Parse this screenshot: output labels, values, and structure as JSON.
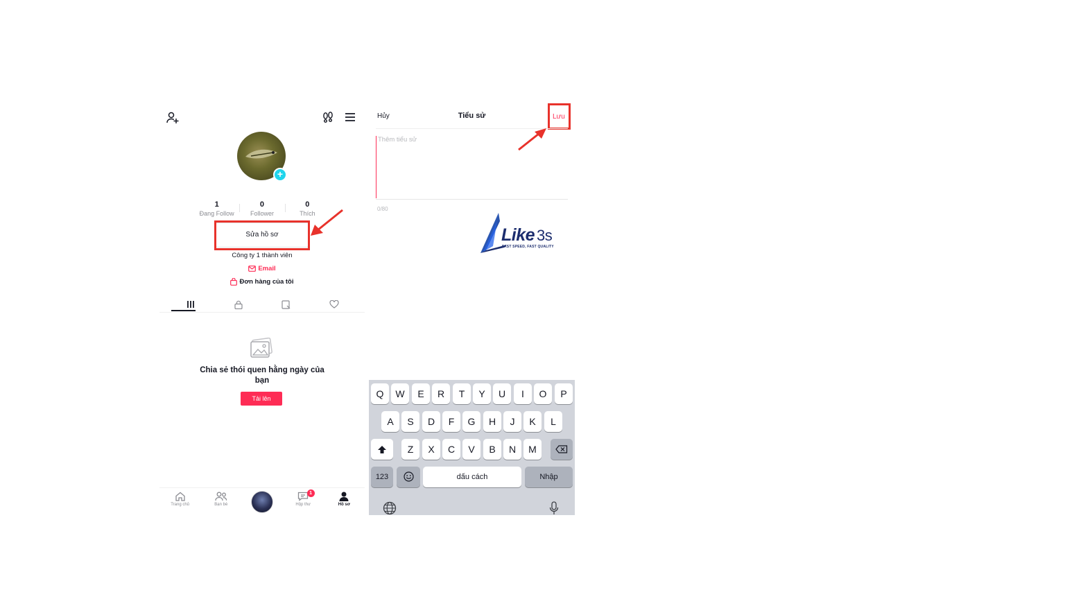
{
  "profile": {
    "stats": [
      {
        "value": "1",
        "label": "Đang Follow"
      },
      {
        "value": "0",
        "label": "Follower"
      },
      {
        "value": "0",
        "label": "Thích"
      }
    ],
    "edit_profile_label": "Sửa hồ sơ",
    "bio_text": "Công ty 1 thành viên",
    "email_label": "Email",
    "orders_label": "Đơn hàng của tôi",
    "empty_title": "Chia sẻ thói quen hằng ngày của bạn",
    "upload_label": "Tải lên",
    "icons": [
      "add-user-icon",
      "footprint-icon",
      "menu-icon",
      "avatar-add-icon",
      "grid-icon",
      "lock-icon",
      "bookmark-icon",
      "liked-icon",
      "empty-photo-icon",
      "mail-icon",
      "bag-icon"
    ]
  },
  "bottom_nav": {
    "items": [
      {
        "label": "Trang chủ",
        "icon": "home-icon"
      },
      {
        "label": "Bạn bè",
        "icon": "friends-icon"
      },
      {
        "label": "",
        "icon": "create-avatar"
      },
      {
        "label": "Hộp thư",
        "icon": "inbox-icon",
        "badge": "1"
      },
      {
        "label": "Hồ sơ",
        "icon": "profile-icon"
      }
    ]
  },
  "bio_editor": {
    "cancel_label": "Hủy",
    "title": "Tiểu sử",
    "save_label": "Lưu",
    "placeholder": "Thêm tiểu sử",
    "char_count": "0/80"
  },
  "watermark": {
    "brand": "Like",
    "brand_number": "3s",
    "tagline": "FAST SPEED, FAST QUALITY"
  },
  "keyboard": {
    "row1": [
      "Q",
      "W",
      "E",
      "R",
      "T",
      "Y",
      "U",
      "I",
      "O",
      "P"
    ],
    "row2": [
      "A",
      "S",
      "D",
      "F",
      "G",
      "H",
      "J",
      "K",
      "L"
    ],
    "row3": [
      "Z",
      "X",
      "C",
      "V",
      "B",
      "N",
      "M"
    ],
    "numbers_label": "123",
    "space_label": "dấu cách",
    "return_label": "Nhập"
  },
  "colors": {
    "accent": "#fe2c55",
    "highlight": "#e8322b",
    "keyboard_bg": "#d1d4db",
    "avatar_badge": "#20d5ec"
  }
}
